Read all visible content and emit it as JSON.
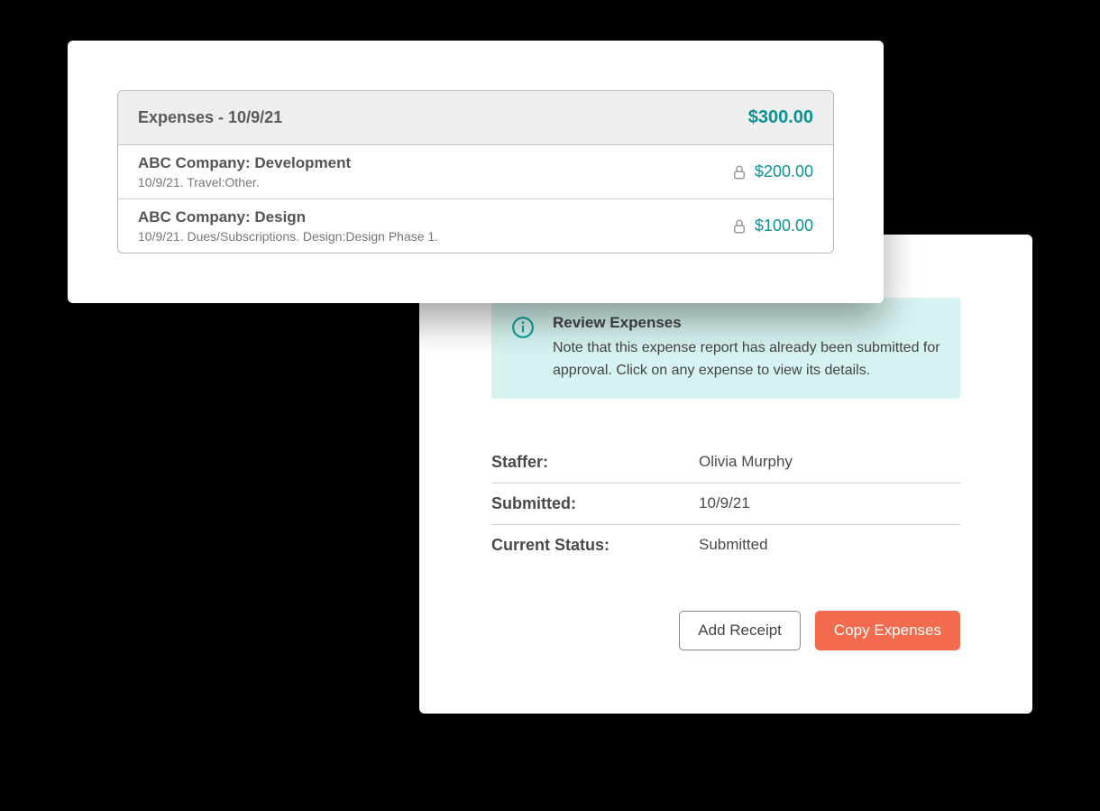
{
  "expenses": {
    "header_title": "Expenses - 10/9/21",
    "header_total": "$300.00",
    "rows": [
      {
        "name": "ABC Company: Development",
        "sub": "10/9/21. Travel:Other.",
        "amount": "$200.00"
      },
      {
        "name": "ABC Company: Design",
        "sub": "10/9/21. Dues/Subscriptions. Design:Design Phase 1.",
        "amount": "$100.00"
      }
    ]
  },
  "review": {
    "title": "Review Expenses",
    "body": "Note that this expense report has already been submitted for approval. Click on any expense to view its details."
  },
  "meta": {
    "staffer_label": "Staffer:",
    "staffer_value": "Olivia Murphy",
    "submitted_label": "Submitted:",
    "submitted_value": "10/9/21",
    "status_label": "Current Status:",
    "status_value": "Submitted"
  },
  "actions": {
    "add_receipt": "Add Receipt",
    "copy_expenses": "Copy Expenses"
  }
}
